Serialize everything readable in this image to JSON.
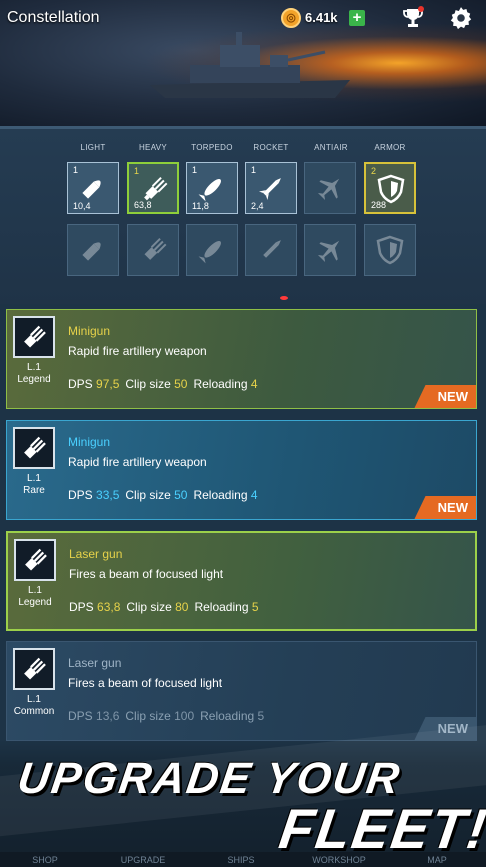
{
  "header": {
    "title": "Constellation",
    "coins": "6.41k",
    "coin_symbol": "◎",
    "plus": "+"
  },
  "categories": [
    {
      "label": "LIGHT",
      "level": "1",
      "value": "10,4",
      "icon": "bullet-icon"
    },
    {
      "label": "HEAVY",
      "level": "1",
      "value": "63,8",
      "icon": "minigun-icon"
    },
    {
      "label": "TORPEDO",
      "level": "1",
      "value": "11,8",
      "icon": "torpedo-icon"
    },
    {
      "label": "ROCKET",
      "level": "1",
      "value": "2,4",
      "icon": "rocket-icon"
    },
    {
      "label": "ANTIAIR",
      "level": "",
      "value": "",
      "icon": "jet-icon"
    },
    {
      "label": "ARMOR",
      "level": "2",
      "value": "288",
      "icon": "shield-icon"
    }
  ],
  "cards": [
    {
      "name": "Minigun",
      "desc": "Rapid fire artillery weapon",
      "level": "L.1",
      "rarity": "Legend",
      "dps_label": "DPS",
      "dps": "97,5",
      "clip_label": "Clip size",
      "clip": "50",
      "reload_label": "Reloading",
      "reload": "4",
      "badge": "NEW"
    },
    {
      "name": "Minigun",
      "desc": "Rapid fire artillery weapon",
      "level": "L.1",
      "rarity": "Rare",
      "dps_label": "DPS",
      "dps": "33,5",
      "clip_label": "Clip size",
      "clip": "50",
      "reload_label": "Reloading",
      "reload": "4",
      "badge": "NEW"
    },
    {
      "name": "Laser gun",
      "desc": "Fires a beam of focused light",
      "level": "L.1",
      "rarity": "Legend",
      "dps_label": "DPS",
      "dps": "63,8",
      "clip_label": "Clip size",
      "clip": "80",
      "reload_label": "Reloading",
      "reload": "5",
      "badge": ""
    },
    {
      "name": "Laser gun",
      "desc": "Fires a beam of focused light",
      "level": "L.1",
      "rarity": "Common",
      "dps_label": "DPS",
      "dps": "13,6",
      "clip_label": "Clip size",
      "clip": "100",
      "reload_label": "Reloading",
      "reload": "5",
      "badge": "NEW"
    }
  ],
  "promo": {
    "line1": "UPGRADE YOUR",
    "line2": "FLEET!"
  },
  "tabs": [
    "SHOP",
    "UPGRADE",
    "SHIPS",
    "WORKSHOP",
    "MAP"
  ]
}
